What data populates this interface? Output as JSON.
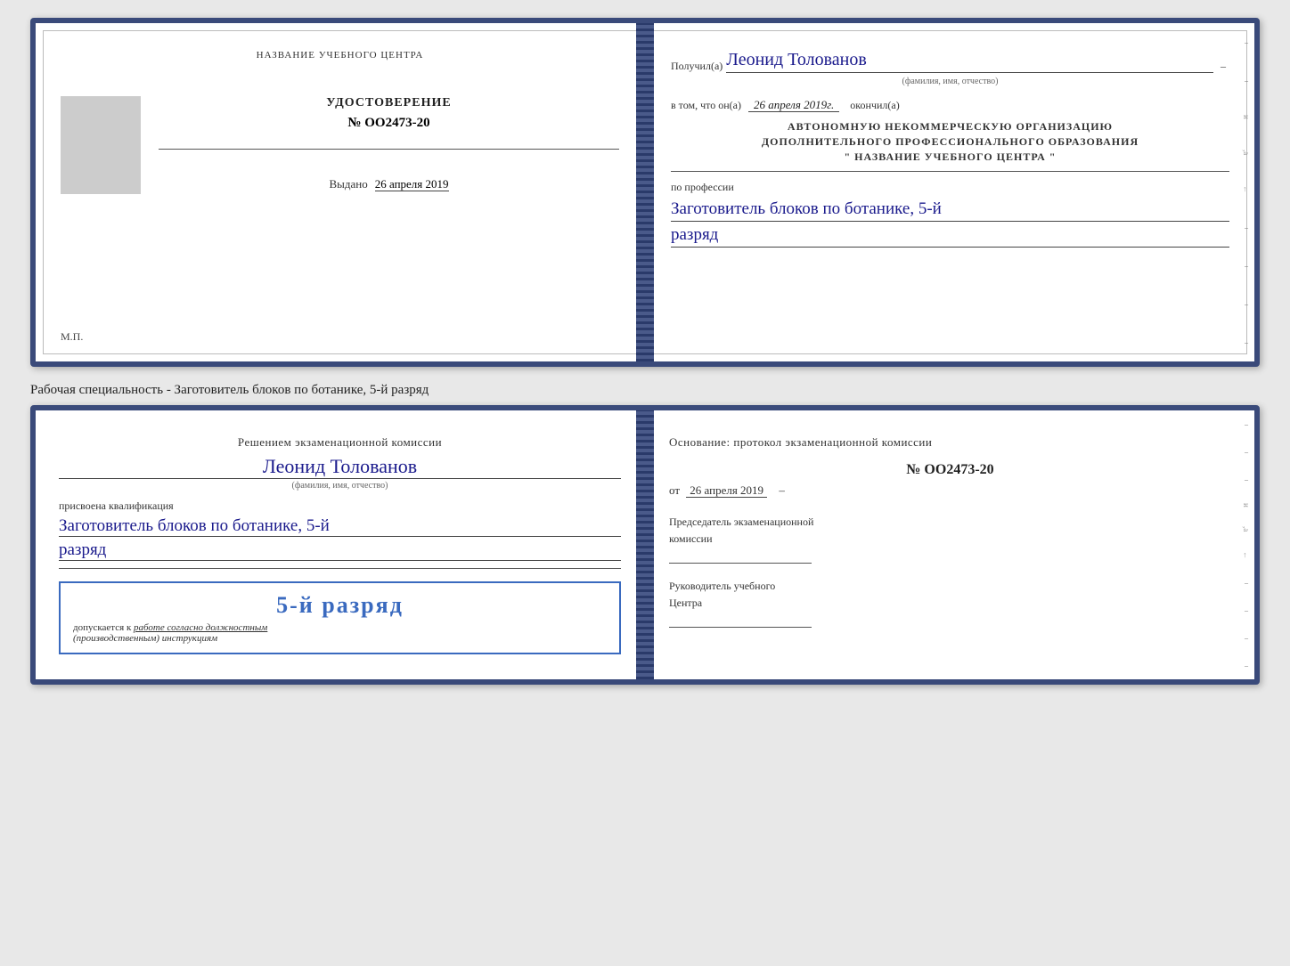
{
  "doc1": {
    "left": {
      "title": "НАЗВАНИЕ УЧЕБНОГО ЦЕНТРА",
      "photo_alt": "фото",
      "udostoverenie_label": "УДОСТОВЕРЕНИЕ",
      "number": "№ OO2473-20",
      "line_placeholder": "",
      "vydano_label": "Выдано",
      "vydano_date": "26 апреля 2019",
      "mp_label": "М.П."
    },
    "right": {
      "poluchil_label": "Получил(а)",
      "recipient_name": "Леонид Толованов",
      "name_subtitle": "(фамилия, имя, отчество)",
      "dash": "–",
      "vtom_label": "в том, что он(а)",
      "date_value": "26 апреля 2019г.",
      "okonchil_label": "окончил(а)",
      "org_line1": "АВТОНОМНУЮ НЕКОММЕРЧЕСКУЮ ОРГАНИЗАЦИЮ",
      "org_line2": "ДОПОЛНИТЕЛЬНОГО ПРОФЕССИОНАЛЬНОГО ОБРАЗОВАНИЯ",
      "org_line3": "\"   НАЗВАНИЕ УЧЕБНОГО ЦЕНТРА   \"",
      "po_professii_label": "по профессии",
      "profession_line1": "Заготовитель блоков по ботанике, 5-й",
      "profession_line2": "разряд"
    }
  },
  "specialty_label": "Рабочая специальность - Заготовитель блоков по ботанике, 5-й разряд",
  "doc2": {
    "left": {
      "resheniem_label": "Решением экзаменационной комиссии",
      "name": "Леонид Толованов",
      "name_subtitle": "(фамилия, имя, отчество)",
      "prisvoena_label": "присвоена квалификация",
      "qualification_line1": "Заготовитель блоков по ботанике, 5-й",
      "qualification_line2": "разряд",
      "stamp_big": "5-й разряд",
      "stamp_dopuskaetsya": "допускается к",
      "stamp_rabota": "работе согласно должностным",
      "stamp_instruktsii": "(производственным) инструкциям"
    },
    "right": {
      "osnovanie_label": "Основание: протокол экзаменационной комиссии",
      "number": "№  OO2473-20",
      "ot_label": "от",
      "date": "26 апреля 2019",
      "predsedatel_line1": "Председатель экзаменационной",
      "predsedatel_line2": "комиссии",
      "rukovoditel_line1": "Руководитель учебного",
      "rukovoditel_line2": "Центра"
    }
  }
}
